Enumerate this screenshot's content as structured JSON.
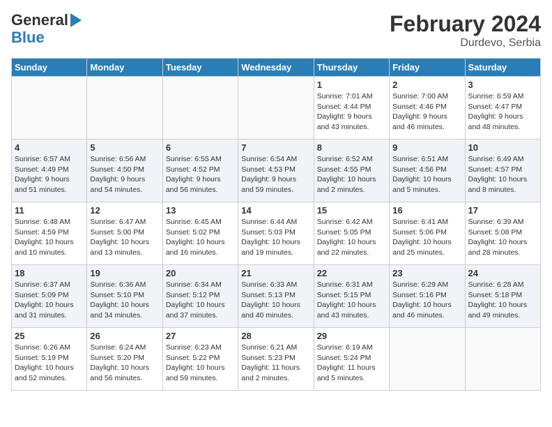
{
  "header": {
    "logo_line1": "General",
    "logo_line2": "Blue",
    "title": "February 2024",
    "subtitle": "Durdevo, Serbia"
  },
  "weekdays": [
    "Sunday",
    "Monday",
    "Tuesday",
    "Wednesday",
    "Thursday",
    "Friday",
    "Saturday"
  ],
  "weeks": [
    [
      {
        "day": "",
        "info": ""
      },
      {
        "day": "",
        "info": ""
      },
      {
        "day": "",
        "info": ""
      },
      {
        "day": "",
        "info": ""
      },
      {
        "day": "1",
        "info": "Sunrise: 7:01 AM\nSunset: 4:44 PM\nDaylight: 9 hours\nand 43 minutes."
      },
      {
        "day": "2",
        "info": "Sunrise: 7:00 AM\nSunset: 4:46 PM\nDaylight: 9 hours\nand 46 minutes."
      },
      {
        "day": "3",
        "info": "Sunrise: 6:59 AM\nSunset: 4:47 PM\nDaylight: 9 hours\nand 48 minutes."
      }
    ],
    [
      {
        "day": "4",
        "info": "Sunrise: 6:57 AM\nSunset: 4:49 PM\nDaylight: 9 hours\nand 51 minutes."
      },
      {
        "day": "5",
        "info": "Sunrise: 6:56 AM\nSunset: 4:50 PM\nDaylight: 9 hours\nand 54 minutes."
      },
      {
        "day": "6",
        "info": "Sunrise: 6:55 AM\nSunset: 4:52 PM\nDaylight: 9 hours\nand 56 minutes."
      },
      {
        "day": "7",
        "info": "Sunrise: 6:54 AM\nSunset: 4:53 PM\nDaylight: 9 hours\nand 59 minutes."
      },
      {
        "day": "8",
        "info": "Sunrise: 6:52 AM\nSunset: 4:55 PM\nDaylight: 10 hours\nand 2 minutes."
      },
      {
        "day": "9",
        "info": "Sunrise: 6:51 AM\nSunset: 4:56 PM\nDaylight: 10 hours\nand 5 minutes."
      },
      {
        "day": "10",
        "info": "Sunrise: 6:49 AM\nSunset: 4:57 PM\nDaylight: 10 hours\nand 8 minutes."
      }
    ],
    [
      {
        "day": "11",
        "info": "Sunrise: 6:48 AM\nSunset: 4:59 PM\nDaylight: 10 hours\nand 10 minutes."
      },
      {
        "day": "12",
        "info": "Sunrise: 6:47 AM\nSunset: 5:00 PM\nDaylight: 10 hours\nand 13 minutes."
      },
      {
        "day": "13",
        "info": "Sunrise: 6:45 AM\nSunset: 5:02 PM\nDaylight: 10 hours\nand 16 minutes."
      },
      {
        "day": "14",
        "info": "Sunrise: 6:44 AM\nSunset: 5:03 PM\nDaylight: 10 hours\nand 19 minutes."
      },
      {
        "day": "15",
        "info": "Sunrise: 6:42 AM\nSunset: 5:05 PM\nDaylight: 10 hours\nand 22 minutes."
      },
      {
        "day": "16",
        "info": "Sunrise: 6:41 AM\nSunset: 5:06 PM\nDaylight: 10 hours\nand 25 minutes."
      },
      {
        "day": "17",
        "info": "Sunrise: 6:39 AM\nSunset: 5:08 PM\nDaylight: 10 hours\nand 28 minutes."
      }
    ],
    [
      {
        "day": "18",
        "info": "Sunrise: 6:37 AM\nSunset: 5:09 PM\nDaylight: 10 hours\nand 31 minutes."
      },
      {
        "day": "19",
        "info": "Sunrise: 6:36 AM\nSunset: 5:10 PM\nDaylight: 10 hours\nand 34 minutes."
      },
      {
        "day": "20",
        "info": "Sunrise: 6:34 AM\nSunset: 5:12 PM\nDaylight: 10 hours\nand 37 minutes."
      },
      {
        "day": "21",
        "info": "Sunrise: 6:33 AM\nSunset: 5:13 PM\nDaylight: 10 hours\nand 40 minutes."
      },
      {
        "day": "22",
        "info": "Sunrise: 6:31 AM\nSunset: 5:15 PM\nDaylight: 10 hours\nand 43 minutes."
      },
      {
        "day": "23",
        "info": "Sunrise: 6:29 AM\nSunset: 5:16 PM\nDaylight: 10 hours\nand 46 minutes."
      },
      {
        "day": "24",
        "info": "Sunrise: 6:28 AM\nSunset: 5:18 PM\nDaylight: 10 hours\nand 49 minutes."
      }
    ],
    [
      {
        "day": "25",
        "info": "Sunrise: 6:26 AM\nSunset: 5:19 PM\nDaylight: 10 hours\nand 52 minutes."
      },
      {
        "day": "26",
        "info": "Sunrise: 6:24 AM\nSunset: 5:20 PM\nDaylight: 10 hours\nand 56 minutes."
      },
      {
        "day": "27",
        "info": "Sunrise: 6:23 AM\nSunset: 5:22 PM\nDaylight: 10 hours\nand 59 minutes."
      },
      {
        "day": "28",
        "info": "Sunrise: 6:21 AM\nSunset: 5:23 PM\nDaylight: 11 hours\nand 2 minutes."
      },
      {
        "day": "29",
        "info": "Sunrise: 6:19 AM\nSunset: 5:24 PM\nDaylight: 11 hours\nand 5 minutes."
      },
      {
        "day": "",
        "info": ""
      },
      {
        "day": "",
        "info": ""
      }
    ]
  ]
}
